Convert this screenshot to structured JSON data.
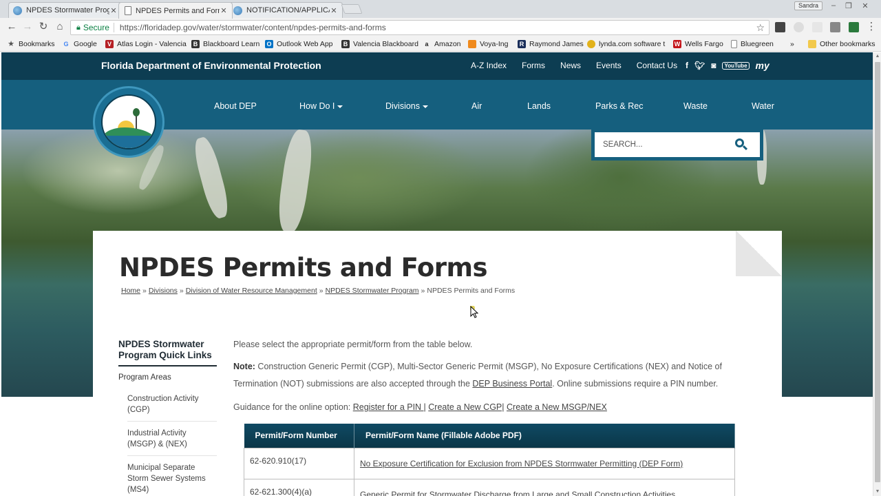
{
  "browser": {
    "tabs": [
      {
        "title": "NPDES Stormwater Prog",
        "active": false
      },
      {
        "title": "NPDES Permits and Form",
        "active": true
      },
      {
        "title": "NOTIFICATION/APPLICA",
        "active": false
      }
    ],
    "profile": "Sandra",
    "secure_label": "Secure",
    "url": "https://floridadep.gov/water/stormwater/content/npdes-permits-and-forms",
    "bookmarks": [
      "Bookmarks",
      "Google",
      "Atlas Login - Valencia",
      "Blackboard Learn",
      "Outlook Web App",
      "Valencia Blackboard",
      "Amazon",
      "Voya-Ing",
      "Raymond James",
      "lynda.com software t",
      "Wells Fargo",
      "Bluegreen",
      "»",
      "Other bookmarks"
    ]
  },
  "site": {
    "agency": "Florida Department of Environmental Protection",
    "top_links": [
      "A-Z Index",
      "Forms",
      "News",
      "Events",
      "Contact Us"
    ],
    "social": [
      "f",
      "t",
      "ig",
      "YouTube",
      "my"
    ],
    "nav": [
      "About DEP",
      "How Do I",
      "Divisions",
      "Air",
      "Lands",
      "Parks & Rec",
      "Waste",
      "Water"
    ],
    "seal_text": "Florida Department of Environmental Protection",
    "search_placeholder": "SEARCH..."
  },
  "page": {
    "title": "NPDES Permits and Forms",
    "breadcrumb": [
      "Home",
      "Divisions",
      "Division of Water Resource Management",
      "NPDES Stormwater Program",
      "NPDES Permits and Forms"
    ],
    "sidebar": {
      "heading": "NPDES Stormwater Program Quick Links",
      "group": "Program Areas",
      "items": [
        "Construction Activity (CGP)",
        "Industrial Activity (MSGP) & (NEX)",
        "Municipal Separate Storm Sewer Systems (MS4)"
      ]
    },
    "intro": "Please select the appropriate permit/form from the table below.",
    "note_label": "Note:",
    "note_text": " Construction Generic Permit (CGP), Multi-Sector Generic Permit (MSGP), No Exposure Certifications (NEX) and Notice of Termination (NOT) submissions are also accepted through the ",
    "note_link": "DEP Business Portal",
    "note_tail": ". Online submissions require a PIN number.",
    "guidance_label": "Guidance for the online option: ",
    "guidance_links": [
      "Register for a PIN |",
      "Create a New CGP|",
      "Create a New MSGP/NEX"
    ],
    "table": {
      "headers": [
        "Permit/Form Number",
        "Permit/Form Name (Fillable Adobe PDF)"
      ],
      "rows": [
        {
          "number": "62-620.910(17)",
          "name": "No Exposure Certification for Exclusion from NPDES Stormwater Permitting (DEP Form)"
        },
        {
          "number": "62-621.300(4)(a)",
          "name": "Generic Permit for Stormwater Discharge from Large and Small Construction Activities"
        }
      ]
    }
  }
}
